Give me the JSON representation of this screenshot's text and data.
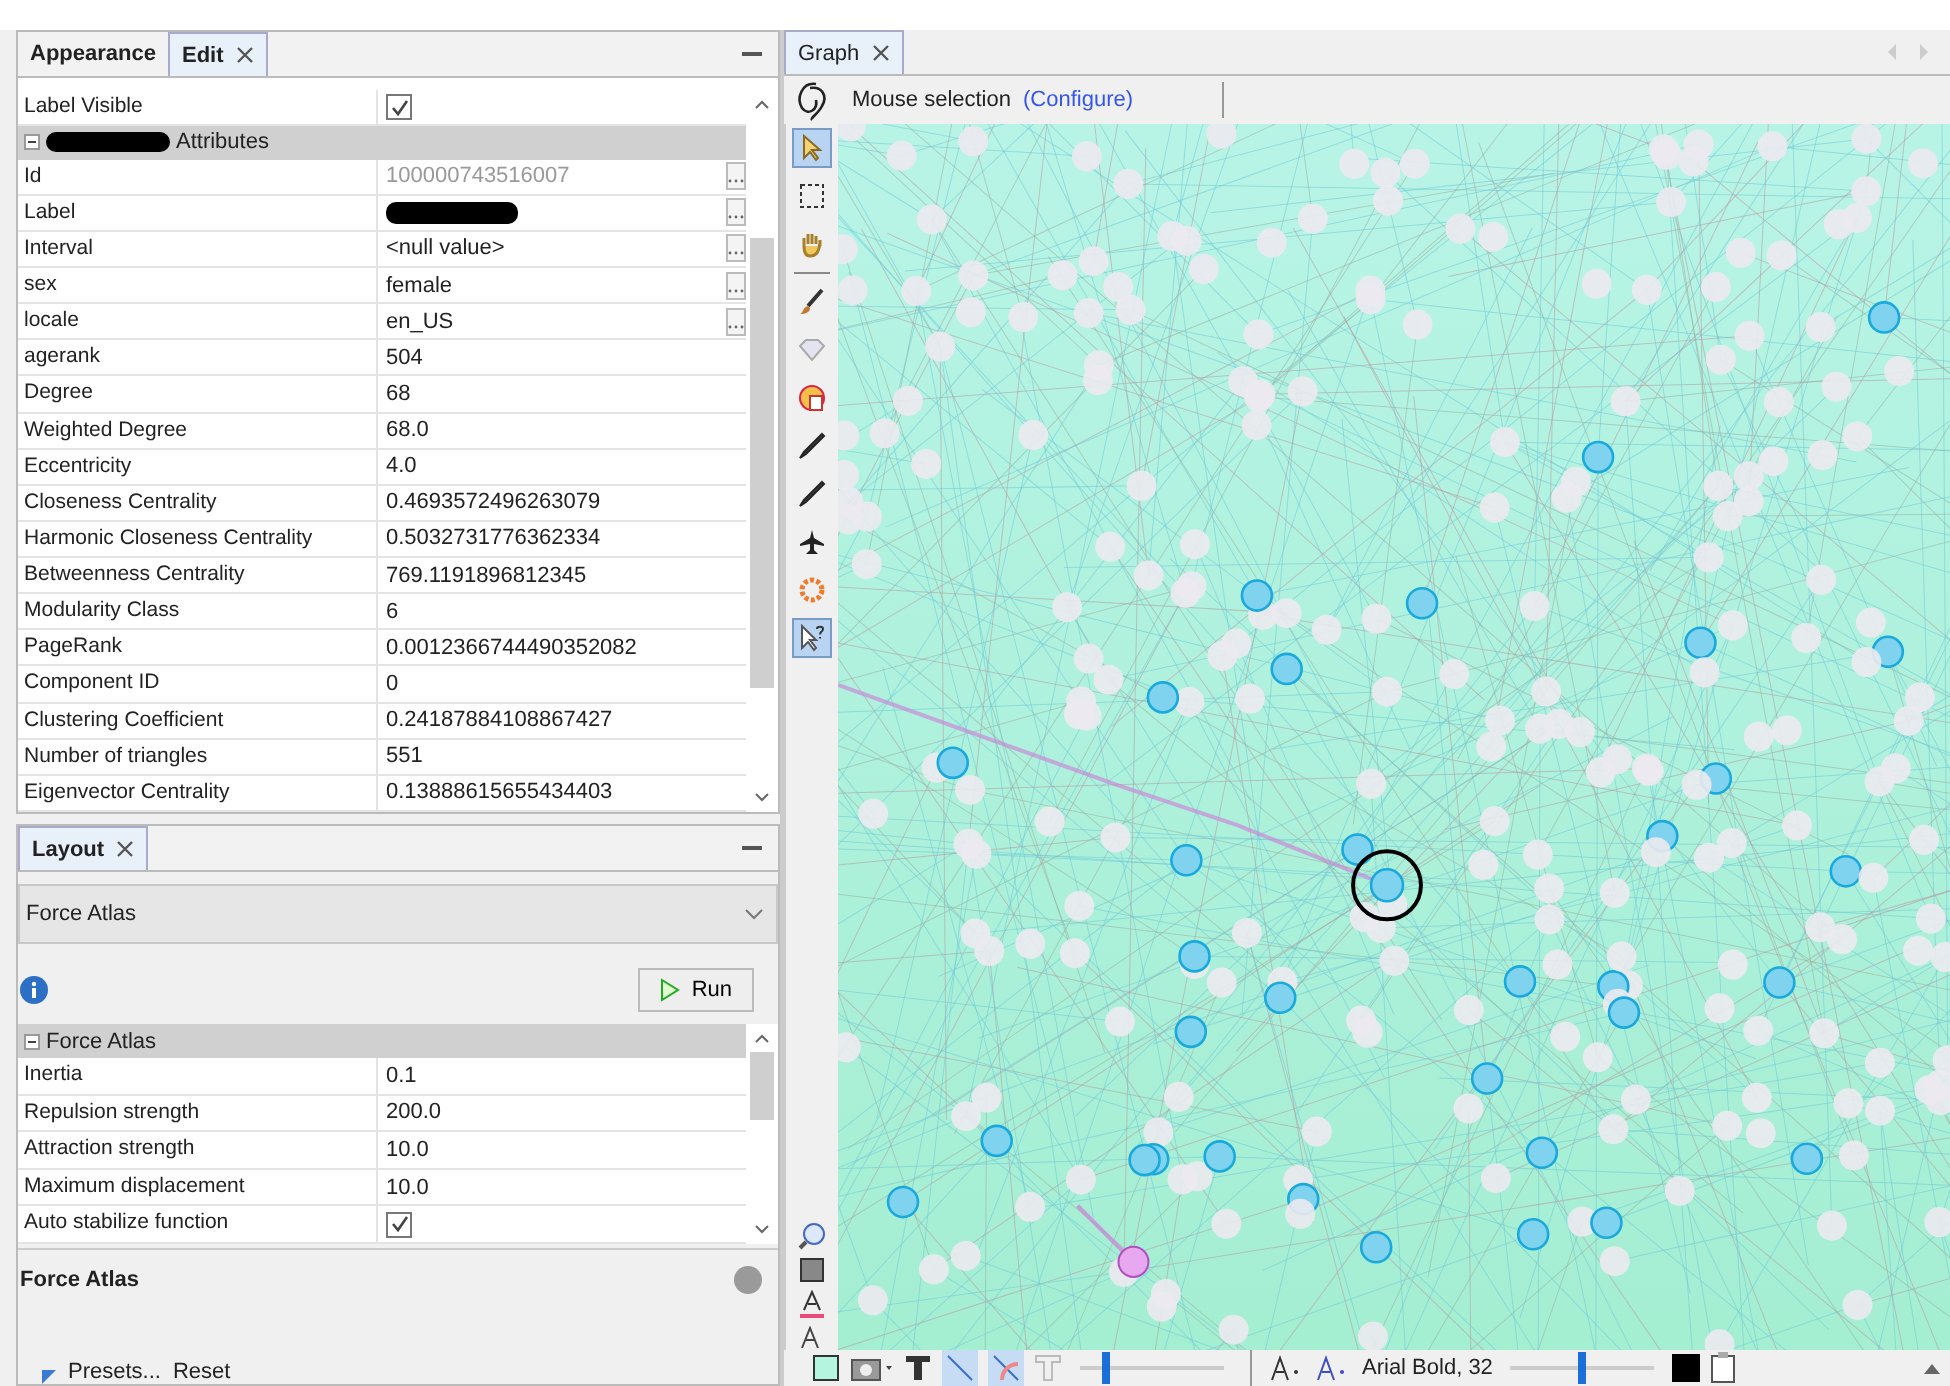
{
  "edit_panel": {
    "tabs": [
      {
        "label": "Appearance",
        "selected": false,
        "closable": false
      },
      {
        "label": "Edit",
        "selected": true,
        "closable": true
      }
    ],
    "top_row": {
      "label": "Label Visible",
      "checked": true
    },
    "section": {
      "title": "Attributes",
      "expanded": true
    },
    "rows": [
      {
        "label": "Id",
        "value": "100000743516007",
        "kind": "text",
        "disabled": true,
        "editor_button": true
      },
      {
        "label": "Label",
        "value": "",
        "kind": "redacted",
        "disabled": false,
        "editor_button": true
      },
      {
        "label": "Interval",
        "value": "<null value>",
        "kind": "text",
        "disabled": false,
        "editor_button": true
      },
      {
        "label": "sex",
        "value": "female",
        "kind": "text",
        "disabled": false,
        "editor_button": true
      },
      {
        "label": "locale",
        "value": "en_US",
        "kind": "text",
        "disabled": false,
        "editor_button": true
      },
      {
        "label": "agerank",
        "value": "504",
        "kind": "text",
        "disabled": false,
        "editor_button": false
      },
      {
        "label": "Degree",
        "value": "68",
        "kind": "text",
        "disabled": false,
        "editor_button": false
      },
      {
        "label": "Weighted Degree",
        "value": "68.0",
        "kind": "text",
        "disabled": false,
        "editor_button": false
      },
      {
        "label": "Eccentricity",
        "value": "4.0",
        "kind": "text",
        "disabled": false,
        "editor_button": false
      },
      {
        "label": "Closeness Centrality",
        "value": "0.4693572496263079",
        "kind": "text",
        "disabled": false,
        "editor_button": false
      },
      {
        "label": "Harmonic Closeness Centrality",
        "value": "0.5032731776362334",
        "kind": "text",
        "disabled": false,
        "editor_button": false
      },
      {
        "label": "Betweenness Centrality",
        "value": "769.1191896812345",
        "kind": "text",
        "disabled": false,
        "editor_button": false
      },
      {
        "label": "Modularity Class",
        "value": "6",
        "kind": "text",
        "disabled": false,
        "editor_button": false
      },
      {
        "label": "PageRank",
        "value": "0.0012366744490352082",
        "kind": "text",
        "disabled": false,
        "editor_button": false
      },
      {
        "label": "Component ID",
        "value": "0",
        "kind": "text",
        "disabled": false,
        "editor_button": false
      },
      {
        "label": "Clustering Coefficient",
        "value": "0.24187884108867427",
        "kind": "text",
        "disabled": false,
        "editor_button": false
      },
      {
        "label": "Number of triangles",
        "value": "551",
        "kind": "text",
        "disabled": false,
        "editor_button": false
      },
      {
        "label": "Eigenvector Centrality",
        "value": "0.13888615655434403",
        "kind": "text",
        "disabled": false,
        "editor_button": false
      }
    ]
  },
  "layout_panel": {
    "tab": {
      "label": "Layout",
      "selected": true
    },
    "algorithm": "Force Atlas",
    "run_button": "Run",
    "section": {
      "title": "Force Atlas",
      "expanded": true
    },
    "properties": [
      {
        "label": "Inertia",
        "value": "0.1",
        "kind": "text"
      },
      {
        "label": "Repulsion strength",
        "value": "200.0",
        "kind": "text"
      },
      {
        "label": "Attraction strength",
        "value": "10.0",
        "kind": "text"
      },
      {
        "label": "Maximum displacement",
        "value": "10.0",
        "kind": "text"
      },
      {
        "label": "Auto stabilize function",
        "checked": true,
        "kind": "checkbox"
      }
    ],
    "description_title": "Force Atlas",
    "presets": "Presets...",
    "reset": "Reset"
  },
  "graph_panel": {
    "tab": {
      "label": "Graph",
      "selected": true
    },
    "mode": "Mouse selection",
    "configure": "(Configure)",
    "tools": [
      {
        "kind": "pointer",
        "selected": true
      },
      {
        "kind": "rect",
        "selected": false
      },
      {
        "kind": "hand",
        "selected": false
      },
      {
        "kind": "divider"
      },
      {
        "kind": "brush",
        "selected": false
      },
      {
        "kind": "diamond",
        "selected": false
      },
      {
        "kind": "palette",
        "selected": false
      },
      {
        "kind": "pencil",
        "selected": false
      },
      {
        "kind": "pencil",
        "selected": false
      },
      {
        "kind": "plane",
        "selected": false
      },
      {
        "kind": "gear",
        "selected": false
      },
      {
        "kind": "help",
        "selected": true
      }
    ],
    "bottom_toolbar": {
      "edges_selected": true,
      "node_label_size": {
        "level": 0.18
      },
      "font": "Arial Bold, 32",
      "edge_label_size": {
        "level": 0.5
      }
    }
  }
}
